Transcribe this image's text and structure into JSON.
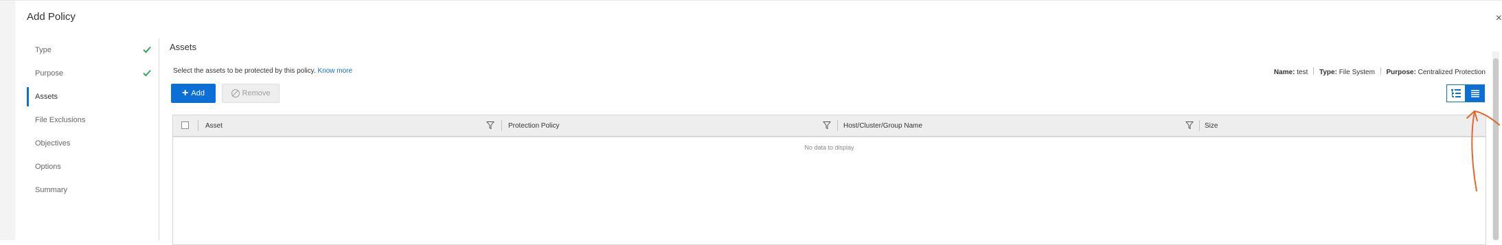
{
  "dialog": {
    "title": "Add Policy",
    "close_symbol": "×"
  },
  "steps": [
    {
      "label": "Type",
      "completed": true
    },
    {
      "label": "Purpose",
      "completed": true
    },
    {
      "label": "Assets",
      "active": true
    },
    {
      "label": "File Exclusions"
    },
    {
      "label": "Objectives"
    },
    {
      "label": "Options"
    },
    {
      "label": "Summary"
    }
  ],
  "assets": {
    "title": "Assets",
    "description": "Select the assets to be protected by this policy.",
    "know_more": "Know more",
    "summary": {
      "name_label": "Name:",
      "name_value": "test",
      "type_label": "Type:",
      "type_value": "File System",
      "purpose_label": "Purpose:",
      "purpose_value": "Centralized Protection"
    },
    "add_label": "Add",
    "remove_label": "Remove"
  },
  "table": {
    "columns": [
      "Asset",
      "Protection Policy",
      "Host/Cluster/Group Name",
      "Size"
    ],
    "empty_text": "No data to display"
  },
  "icons": [
    "check-icon",
    "plus-icon",
    "ban-icon",
    "filter-icon",
    "tree-view-icon",
    "list-view-icon",
    "close-icon"
  ],
  "colors": {
    "accent": "#0b6fd6",
    "success": "#2e9e4f",
    "annotation": "#e8652a"
  }
}
